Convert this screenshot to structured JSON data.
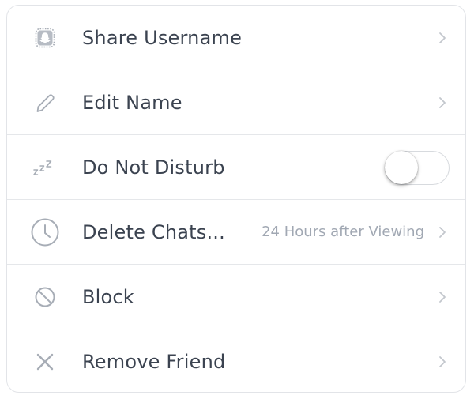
{
  "menu": {
    "items": [
      {
        "label": "Share Username",
        "icon": "snapcode-icon",
        "value": "",
        "control": "chevron"
      },
      {
        "label": "Edit Name",
        "icon": "pencil-icon",
        "value": "",
        "control": "chevron"
      },
      {
        "label": "Do Not Disturb",
        "icon": "sleep-zzz-icon",
        "value": "",
        "control": "toggle",
        "toggle_on": false
      },
      {
        "label": "Delete Chats...",
        "icon": "clock-icon",
        "value": "24 Hours after Viewing",
        "control": "chevron"
      },
      {
        "label": "Block",
        "icon": "block-icon",
        "value": "",
        "control": "chevron"
      },
      {
        "label": "Remove Friend",
        "icon": "x-icon",
        "value": "",
        "control": "chevron"
      }
    ]
  },
  "colors": {
    "label_text": "#3b4350",
    "secondary_text": "#a1a8b3",
    "icon": "#a7adb6",
    "divider": "#e5e7ea"
  }
}
